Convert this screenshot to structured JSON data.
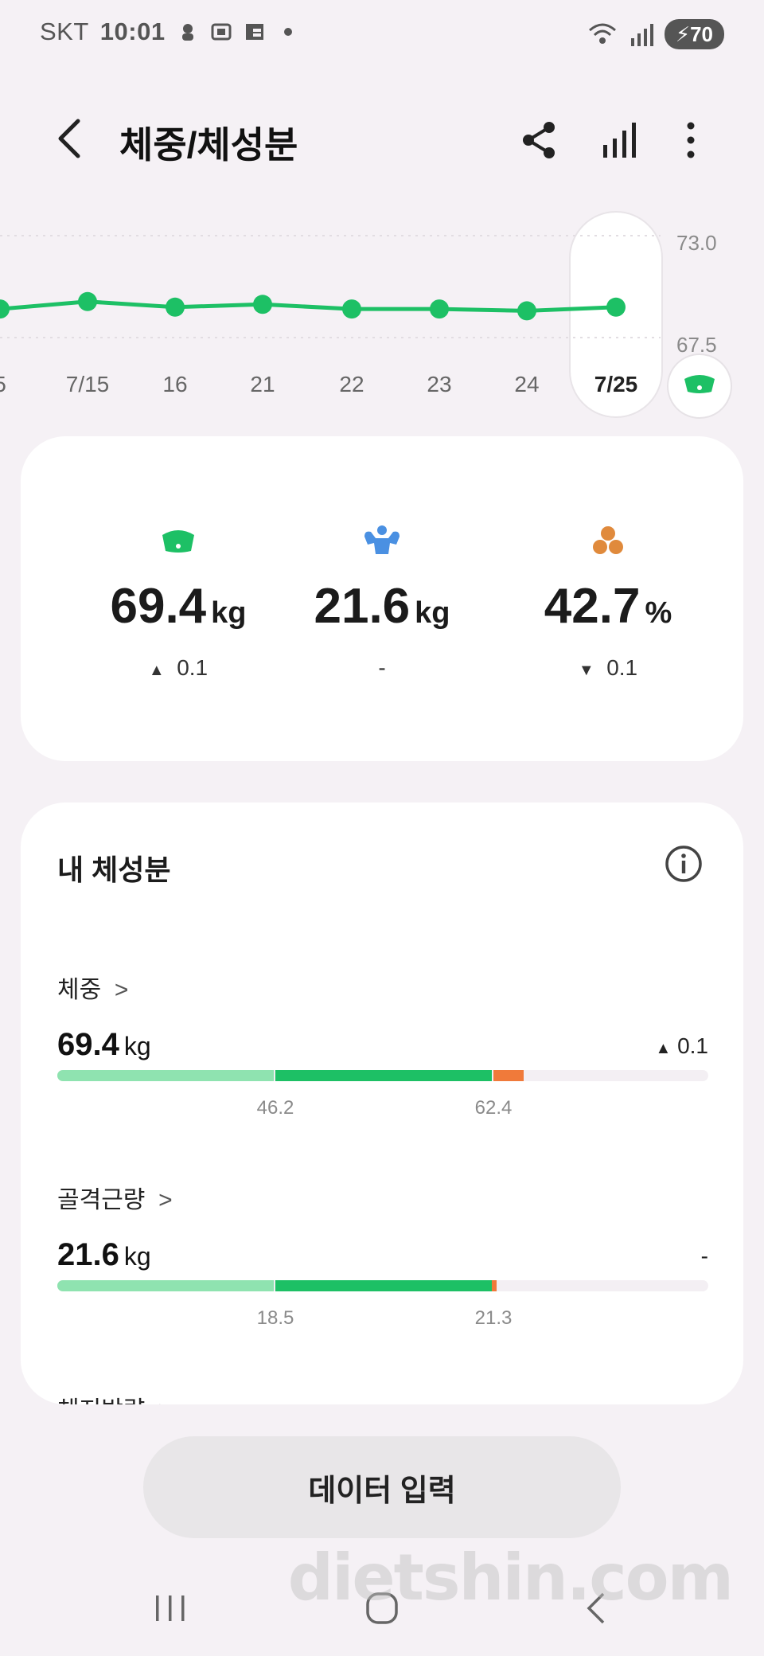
{
  "status_bar": {
    "carrier": "SKT",
    "time": "10:01",
    "battery": "70"
  },
  "header": {
    "title": "체중/체성분"
  },
  "chart_data": {
    "type": "line",
    "x": [
      "5",
      "7/15",
      "16",
      "21",
      "22",
      "23",
      "24",
      "7/25"
    ],
    "series": [
      {
        "values": [
          69.3,
          69.7,
          69.4,
          69.55,
          69.3,
          69.3,
          69.2,
          69.4
        ]
      }
    ],
    "y_ticks": [
      "73.0",
      "67.5"
    ],
    "ylim": [
      67.5,
      73.0
    ],
    "selected": "7/25",
    "color": "#1dc065"
  },
  "summary": {
    "weight": {
      "value": "69.4",
      "unit": "kg",
      "delta": "0.1",
      "direction": "up"
    },
    "muscle": {
      "value": "21.6",
      "unit": "kg",
      "delta": "-"
    },
    "fat": {
      "value": "42.7",
      "unit": "%",
      "delta": "0.1",
      "direction": "down"
    }
  },
  "composition": {
    "title": "내 체성분",
    "sections": [
      {
        "label": "체중",
        "value": "69.4",
        "unit": "kg",
        "delta": "0.1",
        "direction": "up",
        "ticks": [
          "46.2",
          "62.4"
        ],
        "marker_color": "#f07a3a"
      },
      {
        "label": "골격근량",
        "value": "21.6",
        "unit": "kg",
        "delta": "-",
        "ticks": [
          "18.5",
          "21.3"
        ],
        "marker_color": "#f07a3a"
      }
    ],
    "partial_label": "체지방량"
  },
  "colors": {
    "accent": "#1dc065",
    "light_green": "#8fe3b0",
    "orange": "#f07a3a",
    "blue": "#4a90e2",
    "fat_icon": "#e08a3c"
  },
  "buttons": {
    "data_entry": "데이터 입력"
  },
  "watermark": "dietshin.com"
}
